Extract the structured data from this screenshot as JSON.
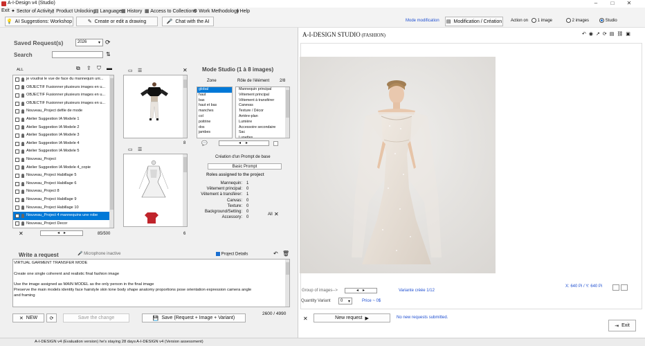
{
  "window": {
    "title": "A-I-Design v4 (Studio)"
  },
  "menu": [
    "Exit",
    "Sector of Activity",
    "Product Unlocking",
    "Language",
    "History",
    "Access to Collections",
    "Work Methodology",
    "Help"
  ],
  "toolbar": {
    "suggestions": "AI Suggestions: Workshop",
    "create_edit": "Create or edit a drawing",
    "chat": "Chat with the AI",
    "mode_label": "Mode modification",
    "mode_btn": "Modification / Création",
    "action_label": "Action on",
    "radio_1": "1 image",
    "radio_2": "2 images",
    "radio_studio": "Studio"
  },
  "left": {
    "saved_title": "Saved Request(s)",
    "year": "2026",
    "search_label": "Search",
    "search_value": "",
    "all_label": "ALL",
    "requests": [
      "je voudrai le vue de face du mannequin uni...",
      "OBJECTIF Fusionner plusieurs images en u...",
      "OBJECTIF Fusionner plusieurs images en u...",
      "OBJECTIF Fusionner plusieurs images en u...",
      "Nouveau_Project defile de mode",
      "Atelier Suggestion IA Modele 1",
      "Atelier Suggestion IA Modele 2",
      "Atelier Suggestion IA Modele 3",
      "Atelier Suggestion IA Modele 4",
      "Atelier Suggestion IA Modele 5",
      "Nouveau_Project",
      "Atelier Suggestion IA Modele 4_copie",
      "Nouveau_Project Habillage 5",
      "Nouveau_Project Habillage 6",
      "Nouveau_Project 8",
      "Nouveau_Project Habillage 9",
      "Nouveau_Project Habillage 10",
      "Nouveau_Project 4 mannequins une robe",
      "Nouveau_Project Decor"
    ],
    "selected_index": 17,
    "count": "85/500"
  },
  "thumbs": {
    "count_top": "8",
    "count_bottom": "6"
  },
  "studio": {
    "title": "Mode Studio (1 à 8 images)",
    "zone_header": "Zone",
    "role_header": "Rôle de l'élément",
    "role_count": "2/8",
    "zones": [
      "global",
      "haut",
      "bas",
      "haut et bas",
      "manches",
      "col",
      "poitrine",
      "dos",
      "jambes"
    ],
    "roles": [
      "Mannequin principal",
      "Vêtement principal",
      "Vêtement à transférer",
      "Canevas",
      "Texture / Décor",
      "Arrière-plan",
      "Lumière",
      "Accessoire secondaire",
      "Sac",
      "Lunettes"
    ],
    "prompt_creation": "Création d'un Prompt de base",
    "basic_prompt": "Basic Prompt",
    "assigned_title": "Roles assigned to the project",
    "assigned": [
      {
        "label": "Mannequin:",
        "value": "1"
      },
      {
        "label": "Vêtement principal:",
        "value": "0"
      },
      {
        "label": "Vêtement à transférer:",
        "value": "1"
      },
      {
        "label": "Canvas:",
        "value": "0"
      },
      {
        "label": "Texture:",
        "value": "0"
      },
      {
        "label": "Background/Setting:",
        "value": "0"
      },
      {
        "label": "Accessory:",
        "value": "0"
      }
    ],
    "all_label": "All"
  },
  "request": {
    "title": "Write a request",
    "mic": "Microphone inactive",
    "project_details": "Project Details",
    "lines": [
      "VIRTUAL GARMENT TRANSFER MODE",
      "",
      "Create one single coherent and realistic final fashion image",
      "",
      "Use the image assigned as MAIN MODEL as the only person in the final image",
      "Preserve the main models identity face hairstyle skin tone body shape anatomy proportions pose orientation expression camera angle",
      "and framing"
    ],
    "new_btn": "NEW",
    "save_change": "Save the change",
    "save_all": "Save (Request + Image + Variant)",
    "char_count": "2600 / 4990"
  },
  "right": {
    "brand": "A-I-DESIGN STUDIO",
    "brand_sub": "(FASHION)",
    "group_label": "Group of images-->",
    "variant_created": "Variante créée 1/12",
    "coords": "X:  640 Pi  /  Y:  640 Pi",
    "qty_label": "Quantity Variant",
    "qty_value": "0",
    "price": "Price ~ 0$",
    "new_request": "New request",
    "no_new": "No new requests submitted.",
    "exit": "Exit"
  },
  "status": {
    "left": "A-I-DESIGN v4 (Evaluation version)  he's staying 28 days",
    "right": "A-I-DESIGN v4  (Version assessment)"
  },
  "colors": {
    "selection": "#0078d7",
    "link_blue": "#1f4fd1"
  }
}
